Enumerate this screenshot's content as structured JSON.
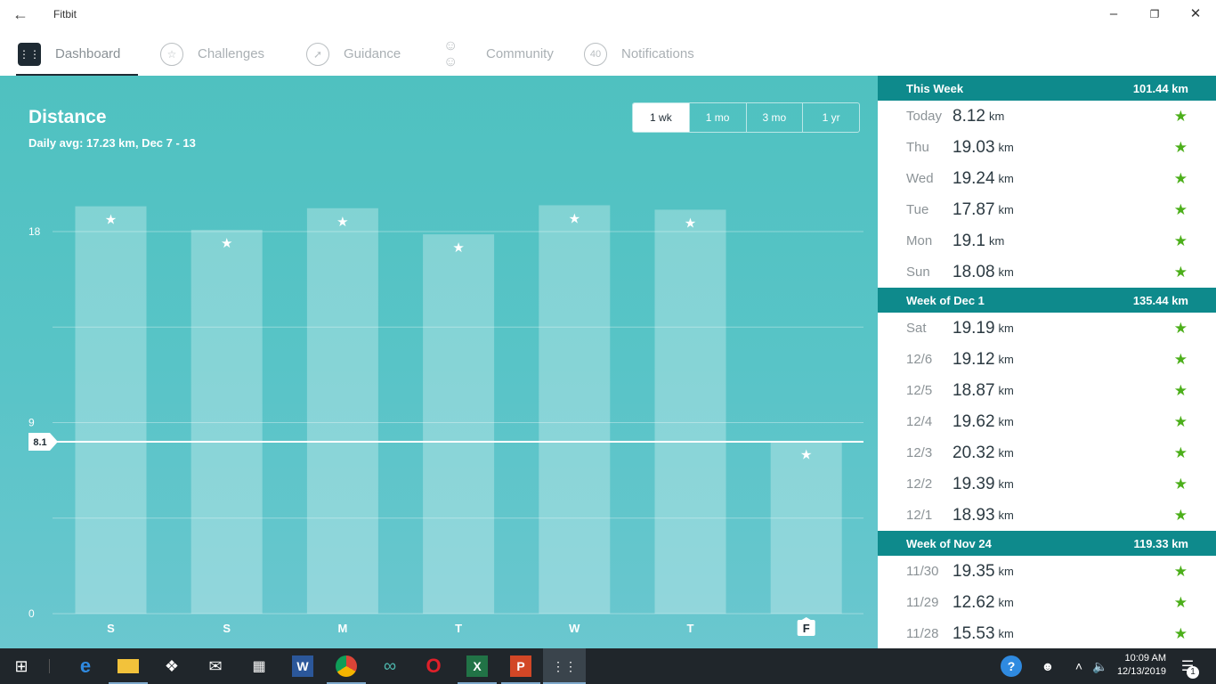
{
  "window": {
    "title": "Fitbit"
  },
  "nav": {
    "tabs": [
      {
        "label": "Dashboard",
        "icon": "fitbit-logo-icon"
      },
      {
        "label": "Challenges",
        "icon": "star-badge-icon"
      },
      {
        "label": "Guidance",
        "icon": "compass-icon"
      },
      {
        "label": "Community",
        "icon": "people-icon"
      },
      {
        "label": "Notifications",
        "icon": "notification-count-icon",
        "badge": "40"
      }
    ]
  },
  "main": {
    "title": "Distance",
    "subtitle": "Daily avg: 17.23 km, Dec 7 - 13",
    "ranges": [
      "1 wk",
      "1 mo",
      "3 mo",
      "1 yr"
    ],
    "selected_range": "1 wk"
  },
  "chart_data": {
    "type": "bar",
    "categories": [
      "S",
      "S",
      "M",
      "T",
      "W",
      "T",
      "F"
    ],
    "values": [
      19.19,
      18.08,
      19.1,
      17.87,
      19.24,
      19.03,
      8.12
    ],
    "goal_met": [
      true,
      true,
      true,
      true,
      true,
      true,
      true
    ],
    "current_marker": {
      "value": 8.1,
      "label": "8.1"
    },
    "yticks": [
      "0",
      "9",
      "18"
    ],
    "ylim": [
      0,
      18
    ],
    "highlight_category_index": 6,
    "grid": true
  },
  "side": {
    "sections": [
      {
        "title": "This Week",
        "total": "101.44 km",
        "rows": [
          {
            "day": "Today",
            "value": "8.12",
            "unit": "km"
          },
          {
            "day": "Thu",
            "value": "19.03",
            "unit": "km"
          },
          {
            "day": "Wed",
            "value": "19.24",
            "unit": "km"
          },
          {
            "day": "Tue",
            "value": "17.87",
            "unit": "km"
          },
          {
            "day": "Mon",
            "value": "19.1",
            "unit": "km"
          },
          {
            "day": "Sun",
            "value": "18.08",
            "unit": "km"
          }
        ]
      },
      {
        "title": "Week of Dec 1",
        "total": "135.44 km",
        "rows": [
          {
            "day": "Sat",
            "value": "19.19",
            "unit": "km"
          },
          {
            "day": "12/6",
            "value": "19.12",
            "unit": "km"
          },
          {
            "day": "12/5",
            "value": "18.87",
            "unit": "km"
          },
          {
            "day": "12/4",
            "value": "19.62",
            "unit": "km"
          },
          {
            "day": "12/3",
            "value": "20.32",
            "unit": "km"
          },
          {
            "day": "12/2",
            "value": "19.39",
            "unit": "km"
          },
          {
            "day": "12/1",
            "value": "18.93",
            "unit": "km"
          }
        ]
      },
      {
        "title": "Week of Nov 24",
        "total": "119.33 km",
        "rows": [
          {
            "day": "11/30",
            "value": "19.35",
            "unit": "km"
          },
          {
            "day": "11/29",
            "value": "12.62",
            "unit": "km"
          },
          {
            "day": "11/28",
            "value": "15.53",
            "unit": "km"
          }
        ]
      }
    ]
  },
  "taskbar": {
    "time": "10:09 AM",
    "date": "12/13/2019",
    "notification_count": "1"
  },
  "colors": {
    "teal_header": "#0e8a8c",
    "panel_bg": "#58c4c7",
    "goal_star": "#4caf1a",
    "taskbar": "#20262b"
  }
}
